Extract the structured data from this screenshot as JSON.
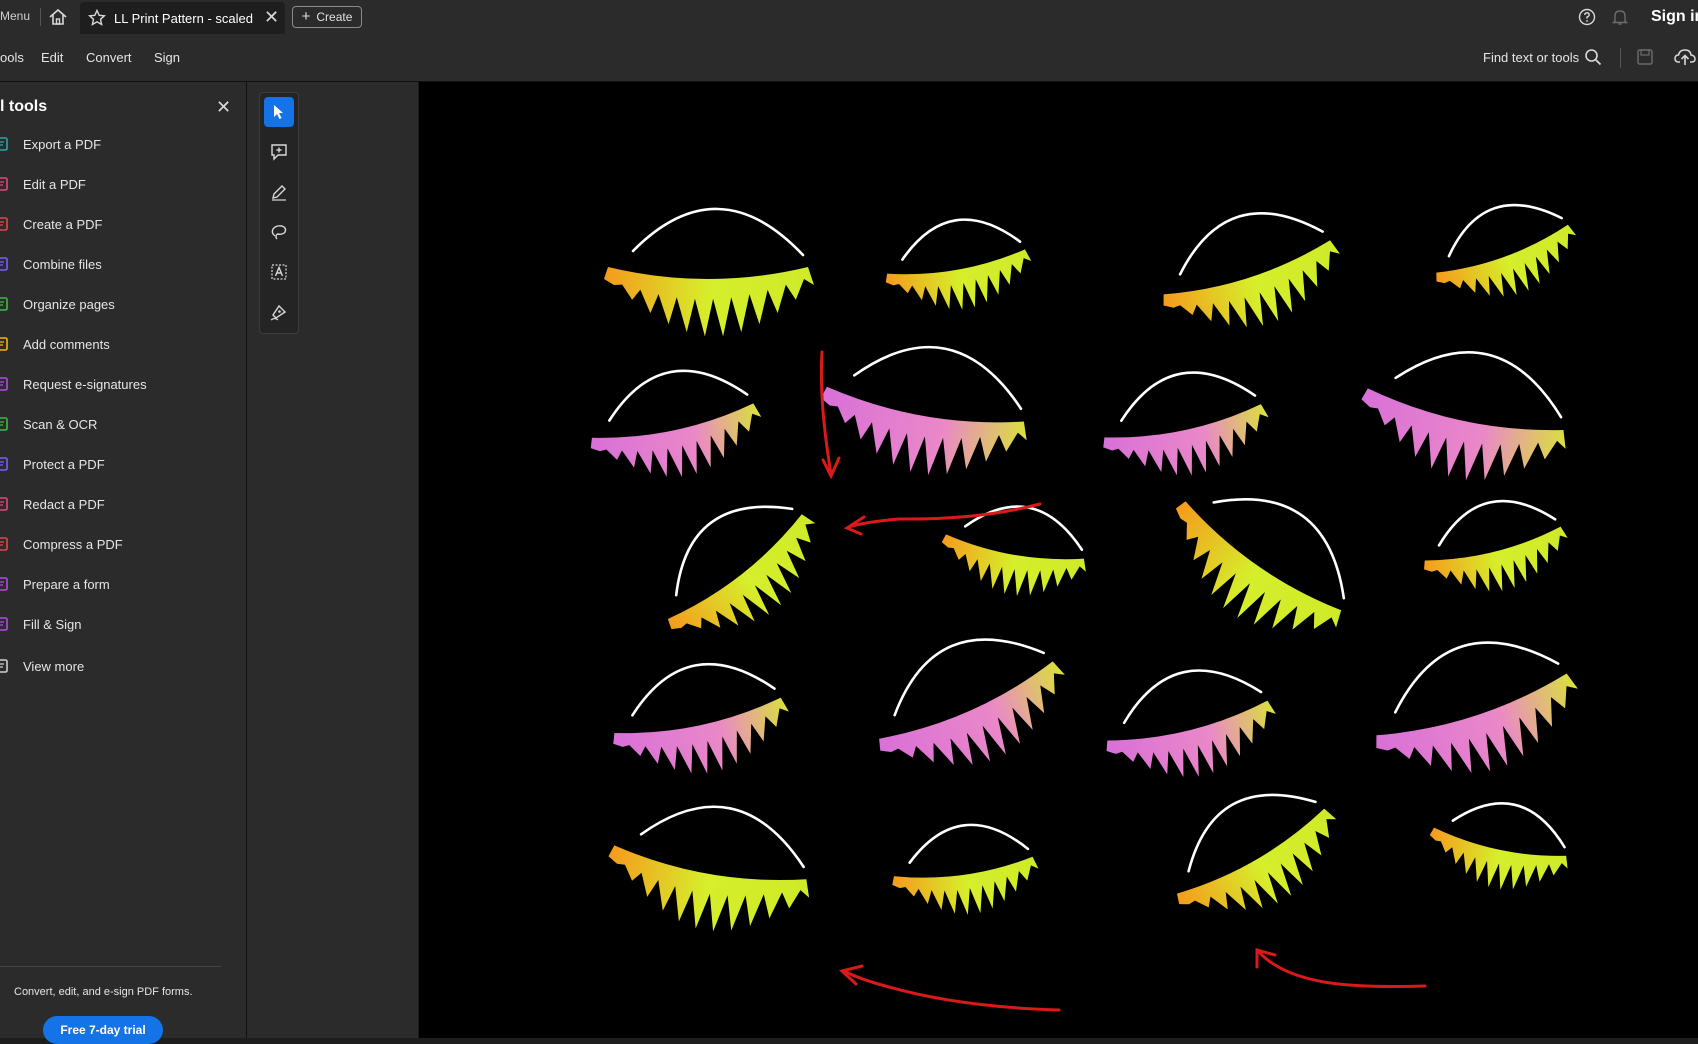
{
  "titlebar": {
    "menu_label": "Menu",
    "tab_label": "LL Print Pattern - scaled...",
    "create_label": "Create",
    "sign_in_label": "Sign in"
  },
  "menubar": {
    "items": [
      "ools",
      "Edit",
      "Convert",
      "Sign"
    ],
    "find_label": "Find text or tools"
  },
  "panel": {
    "title": "l tools",
    "tools": [
      {
        "label": "Export a PDF",
        "color": "#2aa7a7",
        "icon": "export-icon"
      },
      {
        "label": "Edit a PDF",
        "color": "#e0487d",
        "icon": "edit-icon"
      },
      {
        "label": "Create a PDF",
        "color": "#e0484a",
        "icon": "create-icon"
      },
      {
        "label": "Combine files",
        "color": "#7b5cff",
        "icon": "combine-icon"
      },
      {
        "label": "Organize pages",
        "color": "#42b649",
        "icon": "organize-icon"
      },
      {
        "label": "Add comments",
        "color": "#f2b705",
        "icon": "comment-icon"
      },
      {
        "label": "Request e-signatures",
        "color": "#b04de0",
        "icon": "signature-icon"
      },
      {
        "label": "Scan & OCR",
        "color": "#42b649",
        "icon": "scan-icon"
      },
      {
        "label": "Protect a PDF",
        "color": "#7b5cff",
        "icon": "protect-icon"
      },
      {
        "label": "Redact a PDF",
        "color": "#e0487d",
        "icon": "redact-icon"
      },
      {
        "label": "Compress a PDF",
        "color": "#e0484a",
        "icon": "compress-icon"
      },
      {
        "label": "Prepare a form",
        "color": "#b04de0",
        "icon": "form-icon"
      },
      {
        "label": "Fill & Sign",
        "color": "#b04de0",
        "icon": "fill-sign-icon"
      },
      {
        "label": "View more",
        "color": "#cfcfcf",
        "icon": "more-tools-icon"
      }
    ],
    "promo_text": "Convert, edit, and e-sign PDF forms.",
    "trial_label": "Free 7-day trial"
  },
  "colors": {
    "accent": "#1473e6",
    "lash_yellow": "#d4f22b",
    "lash_orange": "#f5a623",
    "lash_pink": "#e07ad8",
    "annotation_red": "#d91a1a"
  }
}
